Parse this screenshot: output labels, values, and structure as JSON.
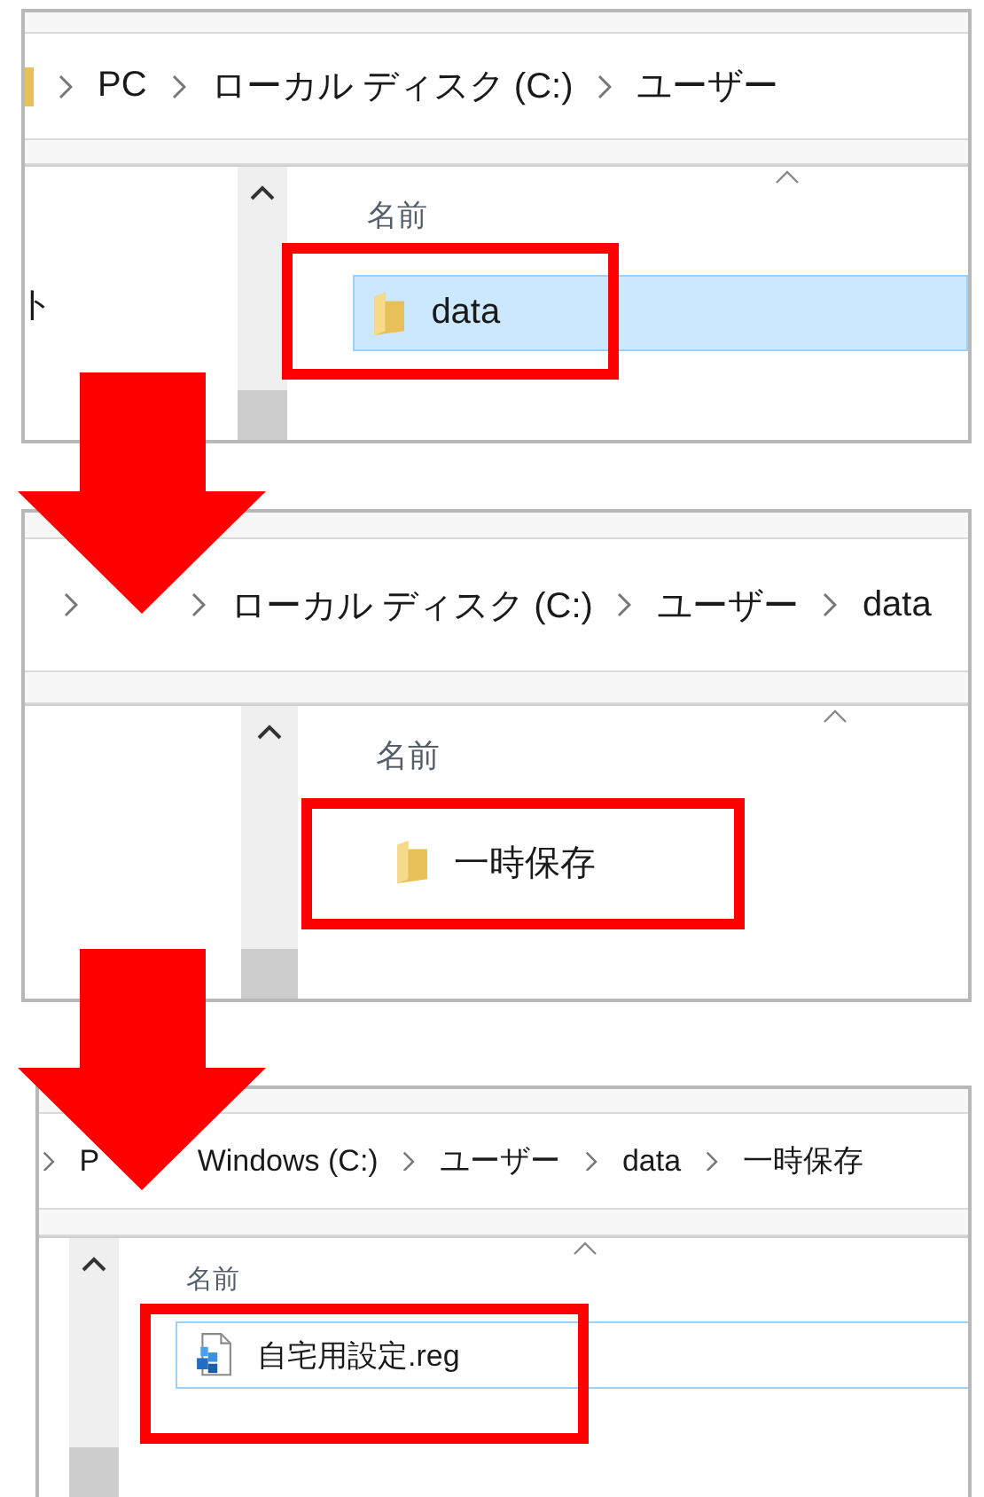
{
  "steps": [
    {
      "breadcrumb": [
        "PC",
        "ローカル ディスク (C:)",
        "ユーザー"
      ],
      "location_icon": true,
      "nav_items": [
        "ト"
      ],
      "column_header": "名前",
      "rows": [
        {
          "name": "data",
          "kind": "folder",
          "selected": true,
          "focused": false,
          "highlighted": true
        }
      ]
    },
    {
      "breadcrumb": [
        "ローカル ディスク (C:)",
        "ユーザー",
        "data"
      ],
      "location_icon": false,
      "column_header": "名前",
      "rows": [
        {
          "name": "一時保存",
          "kind": "folder",
          "selected": false,
          "focused": false,
          "highlighted": true
        }
      ]
    },
    {
      "breadcrumb": [
        "P",
        "Windows (C:)",
        "ユーザー",
        "data",
        "一時保存"
      ],
      "location_icon": false,
      "column_header": "名前",
      "rows": [
        {
          "name": "自宅用設定.reg",
          "kind": "reg",
          "selected": false,
          "focused": true,
          "highlighted": true
        }
      ]
    }
  ]
}
